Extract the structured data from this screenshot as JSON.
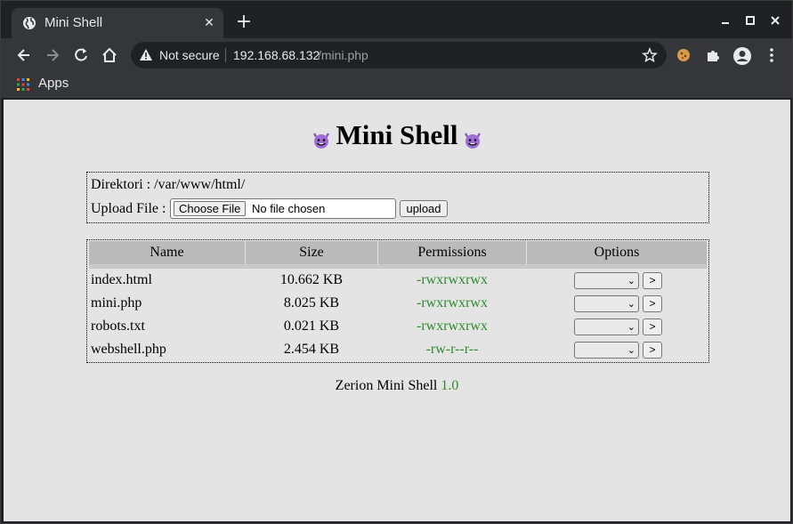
{
  "browser": {
    "tab_title": "Mini Shell",
    "new_tab_label": "+",
    "security_label": "Not secure",
    "url_host": "192.168.68.132",
    "url_path": "/mini.php",
    "bookmarks": {
      "apps_label": "Apps"
    }
  },
  "page": {
    "title": "Mini Shell",
    "directory_text": "Direktori : /var/www/html/",
    "upload_label": "Upload File :",
    "choose_file_label": "Choose File",
    "no_file_label": "No file chosen",
    "upload_button": "upload",
    "table": {
      "headers": [
        "Name",
        "Size",
        "Permissions",
        "Options"
      ],
      "rows": [
        {
          "name": "index.html",
          "size": "10.662 KB",
          "permissions": "-rwxrwxrwx",
          "go": ">"
        },
        {
          "name": "mini.php",
          "size": "8.025 KB",
          "permissions": "-rwxrwxrwx",
          "go": ">"
        },
        {
          "name": "robots.txt",
          "size": "0.021 KB",
          "permissions": "-rwxrwxrwx",
          "go": ">"
        },
        {
          "name": "webshell.php",
          "size": "2.454 KB",
          "permissions": "-rw-r--r--",
          "go": ">"
        }
      ]
    },
    "footer_text": "Zerion Mini Shell",
    "footer_version": "1.0"
  },
  "colors": {
    "page_bg": "#e4e4e4",
    "permissions": "#2e8b2e",
    "table_header_bg": "#bbbbbb",
    "browser_frame": "#202124",
    "toolbar": "#35363a"
  },
  "icons": {
    "heading_emoji": "smiling-devil-icon",
    "tab_favicon": "globe-icon"
  }
}
